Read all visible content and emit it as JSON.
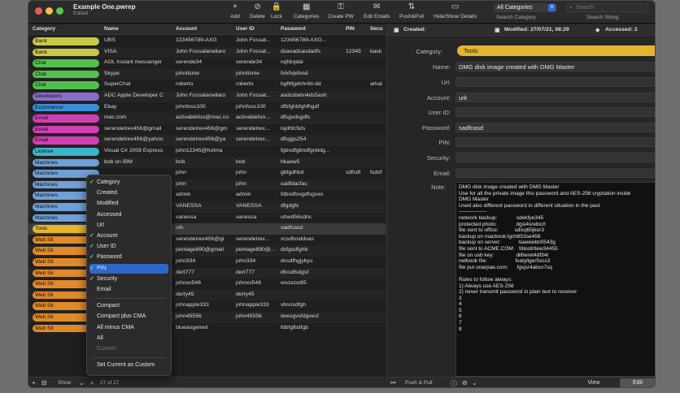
{
  "window": {
    "title": "Example One.pwrep",
    "subtitle": "Edited"
  },
  "toolbar": {
    "items": [
      {
        "label": "Add",
        "icon": "+"
      },
      {
        "label": "Delete",
        "icon": "⊘"
      },
      {
        "label": "Lock",
        "icon": "🔒"
      },
      {
        "label": "Categories",
        "icon": "▦"
      },
      {
        "label": "Create PW",
        "icon": "⚿"
      },
      {
        "label": "Edit Emails",
        "icon": "✉"
      },
      {
        "label": "Push&Pull",
        "icon": "⇅"
      },
      {
        "label": "Hide/Show Details",
        "icon": "▭"
      }
    ],
    "category_value": "All Categories",
    "category_caption": "Search Category",
    "search_placeholder": "Search",
    "search_caption": "Search String"
  },
  "list": {
    "headers": [
      "Category",
      "Name",
      "Account",
      "User ID",
      "Password",
      "PIN",
      "Secu"
    ],
    "rows": [
      {
        "cat": "Bank",
        "color": "#c8c84a",
        "name": "UBS",
        "account": "123456789-AXG",
        "user": "John Fossat...",
        "pw": "123456789-AXG...",
        "pin": "",
        "sec": ""
      },
      {
        "cat": "Bank",
        "color": "#c8c84a",
        "name": "VISA",
        "account": "John Fossatanellaro",
        "user": "John Fossat...",
        "pw": "dsavadsasdadfs",
        "pin": "12345",
        "sec": "kask"
      },
      {
        "cat": "Chat",
        "color": "#52c04f",
        "name": "AOL Instant messanger",
        "account": "serende34",
        "user": "serende34",
        "pw": "nqfdojdal",
        "pin": "",
        "sec": ""
      },
      {
        "cat": "Chat",
        "color": "#52c04f",
        "name": "Skype",
        "account": "johnitsme",
        "user": "johnitsme",
        "pw": "fvlxfvjefosd",
        "pin": "",
        "sec": ""
      },
      {
        "cat": "Chat",
        "color": "#52c04f",
        "name": "SuperChat",
        "account": "roberto",
        "user": "roberto",
        "pw": "bgfbfgdnhnfd-dd",
        "pin": "",
        "sec": "arkal"
      },
      {
        "cat": "Developers",
        "color": "#8a6fc8",
        "name": "ADC Apple Developer C",
        "account": "John Fossatanellaro",
        "user": "John Fossat...",
        "pw": "asdcidahn4ds5ash",
        "pin": "",
        "sec": ""
      },
      {
        "cat": "Ecommerce",
        "color": "#3c8fd8",
        "name": "Ebay",
        "account": "johnfoss100",
        "user": "johnfoss100",
        "pw": "dfbfghbfghfhgdf",
        "pin": "",
        "sec": ""
      },
      {
        "cat": "Email",
        "color": "#d23fb5",
        "name": "mac.com",
        "account": "activablefoo@mac.co",
        "user": "activablefoo...",
        "pw": "dfsgvdsgdfs",
        "pin": "",
        "sec": ""
      },
      {
        "cat": "Email",
        "color": "#d23fb5",
        "name": "serendetrex456@gmail",
        "account": "serendetrex456@gm",
        "user": "serendetrex...",
        "pw": "isjdhfc5ds",
        "pin": "",
        "sec": ""
      },
      {
        "cat": "Email",
        "color": "#d23fb5",
        "name": "serendetrex456@yahoo",
        "account": "serendetrex456@ya",
        "user": "serendetrex...",
        "pw": "dfsggs254",
        "pin": "",
        "sec": ""
      },
      {
        "cat": "License",
        "color": "#3ab6c8",
        "name": "Visual C# 2008 Express",
        "account": "john12345@hotma",
        "user": "",
        "pw": "fgbndfgbndfgnbdg...",
        "pin": "",
        "sec": ""
      },
      {
        "cat": "Machines",
        "color": "#6fa0d8",
        "name": "bob on IBM",
        "account": "bob",
        "user": "bob",
        "pw": "hkaew5",
        "pin": "",
        "sec": ""
      },
      {
        "cat": "Machines",
        "color": "#6fa0d8",
        "name": "",
        "account": "john",
        "user": "john",
        "pw": "gbfgdhbd",
        "pin": "sdfsdf",
        "sec": "fsdsf"
      },
      {
        "cat": "Machines",
        "color": "#6fa0d8",
        "name": "",
        "account": "john",
        "user": "john",
        "pw": "sadfdacfac",
        "pin": "",
        "sec": ""
      },
      {
        "cat": "Machines",
        "color": "#6fa0d8",
        "name": "",
        "account": "admin",
        "user": "admin",
        "pw": "fdbvdfsvgdfsgves",
        "pin": "",
        "sec": ""
      },
      {
        "cat": "Machines",
        "color": "#6fa0d8",
        "name": "",
        "account": "VANESSA",
        "user": "VANESSA",
        "pw": "dfgdgfs",
        "pin": "",
        "sec": ""
      },
      {
        "cat": "Machines",
        "color": "#6fa0d8",
        "name": "ac",
        "account": "vanessa",
        "user": "vanessa",
        "pw": "uhwd56sdnc",
        "pin": "",
        "sec": ""
      },
      {
        "cat": "Tools",
        "color": "#e3b42d",
        "name": "ge created",
        "account": "urk",
        "user": "",
        "pw": "sadfcasd",
        "pin": "",
        "sec": "",
        "selected": true
      },
      {
        "cat": "Web Sit",
        "color": "#e08a2a",
        "name": "",
        "account": "serendetrex456@gi",
        "user": "serendetrex...",
        "pw": "xcsdfvsddvas",
        "pin": "",
        "sec": ""
      },
      {
        "cat": "Web Sit",
        "color": "#e08a2a",
        "name": "",
        "account": "pentage890@gmail",
        "user": "pentage890@...",
        "pw": "dsfgsdfghb",
        "pin": "",
        "sec": ""
      },
      {
        "cat": "Web Sit",
        "color": "#e08a2a",
        "name": "",
        "account": "john334",
        "user": "john334",
        "pw": "dvsdfhgjykyu",
        "pin": "",
        "sec": ""
      },
      {
        "cat": "Web Sit",
        "color": "#e08a2a",
        "name": "",
        "account": "dert777",
        "user": "dert777",
        "pw": "dfvsdfsdgsf",
        "pin": "",
        "sec": ""
      },
      {
        "cat": "Web Sit",
        "color": "#e08a2a",
        "name": "",
        "account": "johnxx546",
        "user": "johnxx546",
        "pw": "wsoxzvdt5",
        "pin": "",
        "sec": ""
      },
      {
        "cat": "Web Sit",
        "color": "#e08a2a",
        "name": "",
        "account": "derty45",
        "user": "derty45",
        "pw": "",
        "pin": "",
        "sec": ""
      },
      {
        "cat": "Web Sit",
        "color": "#e08a2a",
        "name": "",
        "account": "johnapple333",
        "user": "johnapple333",
        "pw": "vbsnsdfgh",
        "pin": "",
        "sec": ""
      },
      {
        "cat": "Web Sit",
        "color": "#e08a2a",
        "name": "",
        "account": "john45556",
        "user": "john45556",
        "pw": "dvesgvsfdgvesf",
        "pin": "",
        "sec": ""
      },
      {
        "cat": "Web Sit",
        "color": "#e08a2a",
        "name": "",
        "account": "blueangelred",
        "user": "",
        "pw": "fdbfgfbdfgb",
        "pin": "",
        "sec": ""
      }
    ],
    "footer": {
      "show": "Show",
      "count": "27 of 27"
    }
  },
  "menu": {
    "items": [
      {
        "label": "Category",
        "checked": true
      },
      {
        "label": "Created",
        "checked": false
      },
      {
        "label": "Modified",
        "checked": false
      },
      {
        "label": "Accessed",
        "checked": false
      },
      {
        "label": "Url",
        "checked": false
      },
      {
        "label": "Account",
        "checked": true
      },
      {
        "label": "User ID",
        "checked": true
      },
      {
        "label": "Password",
        "checked": true
      },
      {
        "label": "PIN",
        "checked": true,
        "highlight": true
      },
      {
        "label": "Security",
        "checked": true
      },
      {
        "label": "Email",
        "checked": false
      },
      {
        "label": "Compact",
        "checked": false,
        "sep_before": true
      },
      {
        "label": "Compact plus CMA",
        "checked": false
      },
      {
        "label": "All minus CMA",
        "checked": false
      },
      {
        "label": "All",
        "checked": false
      },
      {
        "label": "Custom",
        "checked": false,
        "dim": true
      },
      {
        "label": "Set Current as Custom",
        "checked": false,
        "sep_before": true
      }
    ]
  },
  "detail": {
    "created": "Created:",
    "modified": "Modified: 27/07/21, 08:29",
    "accessed": "Accessed: 2",
    "labels": {
      "category": "Category:",
      "name": "Name:",
      "url": "Url:",
      "account": "Account:",
      "userid": "User ID:",
      "password": "Password:",
      "pin": "PIN:",
      "security": "Security:",
      "email": "Email:",
      "note": "Note:"
    },
    "category": "Tools",
    "name": "DMG disk image created with DMG Master",
    "url": "",
    "account": "urk",
    "userid": "",
    "password": "sadfcasd",
    "pin": "",
    "security": "",
    "email": "",
    "note_lines": [
      "DMG disk image created with DMG Master",
      "Use for all the private image this password and AES-256 cryptation inside",
      "DMG Master",
      "Used also different password in different situation in the past",
      "----------------",
      "network backup:             sdekfye345",
      "protected photo:             dgsi4srebxzl",
      "file sent to office:           sdicq65jker3",
      "backup on macbook:lgch653se456",
      "backup on server:            lsaeewbn0543g",
      "file sent to ACME.COM:   fdiootritew34455",
      "file on usb key:               dilllwret4df34r",
      "netbook file:                   fsatyllger5scs3",
      "file put onarpae.com:      fgsjsr4absx7sq",
      "",
      "Rules to follow always:",
      "1) Always use AES-256",
      "2) never transmit password in plain text to receiver",
      "3",
      "4",
      "5",
      "6",
      "7",
      "8"
    ],
    "footer": {
      "pushpull": "Push & Pull",
      "view": "View",
      "edit": "Edit"
    }
  }
}
